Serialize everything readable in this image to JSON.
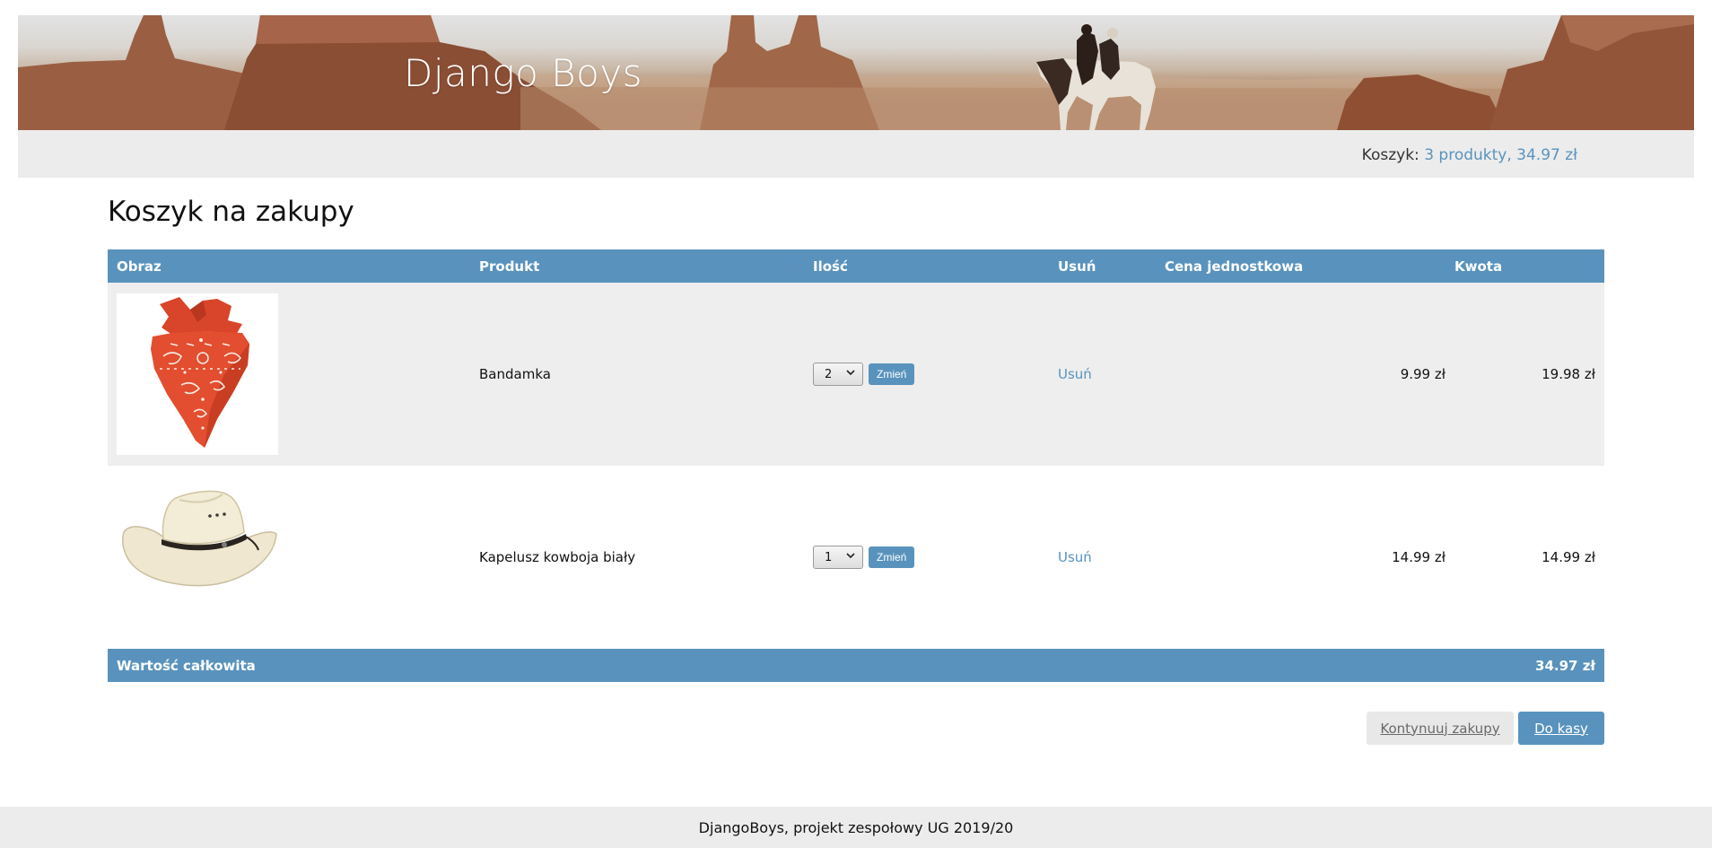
{
  "site": {
    "title": "Django Boys"
  },
  "cart_summary": {
    "label": "Koszyk:",
    "link_text": "3 produkty, 34.97 zł"
  },
  "page": {
    "title": "Koszyk na zakupy"
  },
  "table": {
    "headers": [
      "Obraz",
      "Produkt",
      "Ilość",
      "Usuń",
      "Cena jednostkowa",
      "Kwota"
    ],
    "rows": [
      {
        "image": "orange-bandana",
        "product": "Bandamka",
        "quantity": "2",
        "update_label": "Zmień",
        "remove_label": "Usuń",
        "unit_price": "9.99 zł",
        "amount": "19.98 zł"
      },
      {
        "image": "white-cowboy-hat",
        "product": "Kapelusz kowboja biały",
        "quantity": "1",
        "update_label": "Zmień",
        "remove_label": "Usuń",
        "unit_price": "14.99 zł",
        "amount": "14.99 zł"
      }
    ],
    "total_label": "Wartość całkowita",
    "total_value": "34.97 zł"
  },
  "actions": {
    "continue_label": "Kontynuuj zakupy",
    "checkout_label": "Do kasy"
  },
  "footer": {
    "text": "DjangoBoys, projekt zespołowy UG 2019/20"
  },
  "colors": {
    "accent": "#5993bd",
    "band": "#ececec",
    "row_alt": "#eeeeee"
  }
}
